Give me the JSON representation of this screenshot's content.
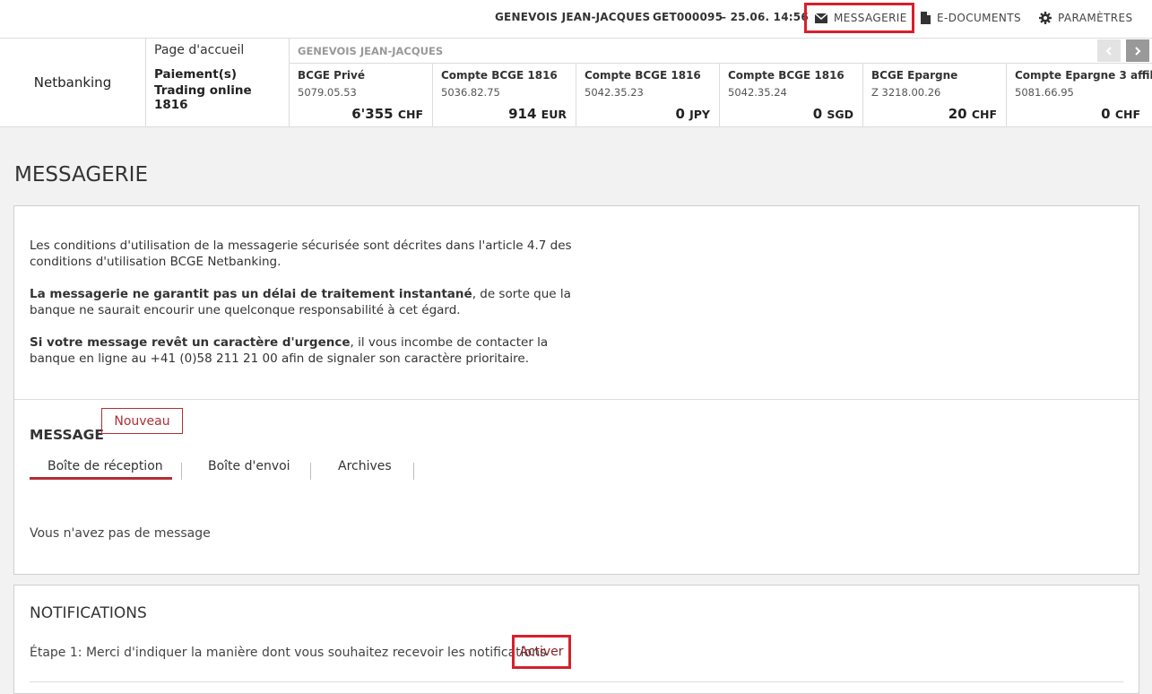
{
  "header": {
    "user_name": "GENEVOIS JEAN-JACQUES",
    "session": "GET000095",
    "datetime": "– 25.06. 14:56",
    "nav": [
      {
        "label": "MESSAGERIE",
        "icon": "envelope-icon"
      },
      {
        "label": "E-DOCUMENTS",
        "icon": "document-icon"
      },
      {
        "label": "PARAMÈTRES",
        "icon": "gear-icon"
      }
    ]
  },
  "band": {
    "brand": "Netbanking",
    "home_link": "Page d'accueil",
    "links": [
      "Paiement(s)",
      "Trading online 1816"
    ],
    "owner": "GENEVOIS JEAN-JACQUES",
    "accounts": [
      {
        "name": "BCGE Privé",
        "number": "5079.05.53",
        "amount": "6'355",
        "currency": "CHF"
      },
      {
        "name": "Compte BCGE 1816",
        "number": "5036.82.75",
        "amount": "914",
        "currency": "EUR"
      },
      {
        "name": "Compte BCGE 1816",
        "number": "5042.35.23",
        "amount": "0",
        "currency": "JPY"
      },
      {
        "name": "Compte BCGE 1816",
        "number": "5042.35.24",
        "amount": "0",
        "currency": "SGD"
      },
      {
        "name": "BCGE Epargne",
        "number": "Z 3218.00.26",
        "amount": "20",
        "currency": "CHF"
      },
      {
        "name": "Compte Epargne 3 affili",
        "number": "5081.66.95",
        "amount": "0",
        "currency": "CHF"
      }
    ]
  },
  "page": {
    "title": "MESSAGERIE",
    "info": {
      "p1": "Les conditions d'utilisation de la messagerie sécurisée sont décrites dans l'article 4.7 des conditions d'utilisation BCGE Netbanking.",
      "p2_bold": "La messagerie ne garantit pas un délai de traitement instantané",
      "p2_rest": ", de sorte que la banque ne saurait encourir une quelconque responsabilité à cet égard.",
      "p3_bold": "Si votre message revêt un caractère d'urgence",
      "p3_rest": ", il vous incombe de contacter la banque en ligne au +41 (0)58 211 21 00 afin de signaler son caractère prioritaire."
    },
    "message": {
      "heading": "MESSAGE",
      "new_button": "Nouveau",
      "tabs": [
        "Boîte de réception",
        "Boîte d'envoi",
        "Archives"
      ],
      "empty": "Vous n'avez pas de message"
    },
    "notifications": {
      "heading": "NOTIFICATIONS",
      "step": "Étape 1: Merci d'indiquer la manière dont vous souhaitez recevoir les notifications",
      "activate": "Activer"
    }
  },
  "colors": {
    "accent": "#b32e35",
    "highlight": "#d6202b",
    "background": "#f2f2f2"
  }
}
